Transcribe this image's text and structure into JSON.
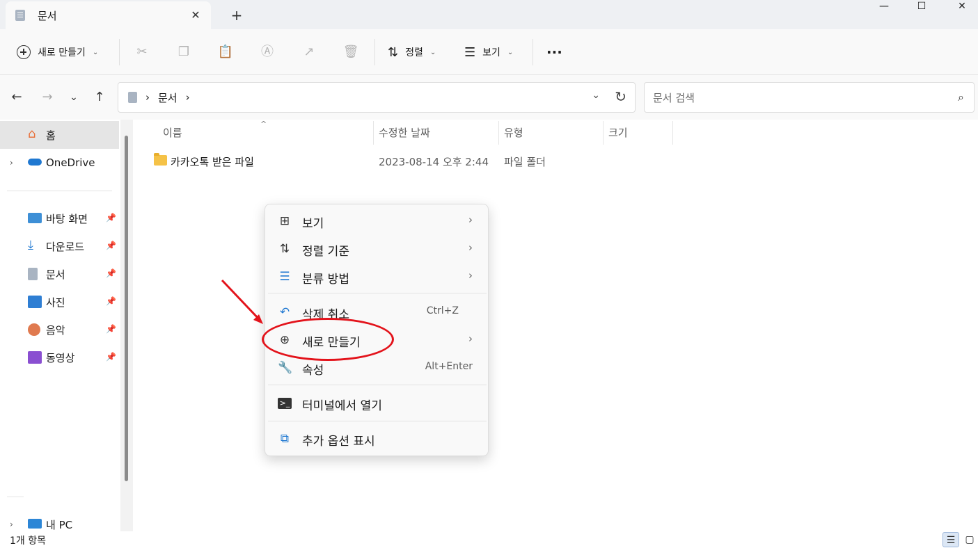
{
  "window": {
    "tab_title": "문서",
    "tab_close": "✕",
    "new_tab": "+",
    "minimize": "—",
    "maximize": "☐",
    "close": "✕"
  },
  "toolbar": {
    "new_label": "새로 만들기",
    "sort_label": "정렬",
    "view_label": "보기",
    "more_label": "···",
    "icons": [
      "cut-icon",
      "copy-icon",
      "paste-icon",
      "rename-icon",
      "share-icon",
      "delete-icon"
    ]
  },
  "address": {
    "location": "문서",
    "separator": "›",
    "search_placeholder": "문서 검색"
  },
  "sidebar": {
    "items": [
      {
        "label": "홈",
        "icon": "home-icon",
        "selected": true
      },
      {
        "label": "OneDrive",
        "icon": "onedrive-icon"
      },
      {
        "label": "바탕 화면",
        "icon": "desktop-icon",
        "pinned": true
      },
      {
        "label": "다운로드",
        "icon": "download-icon",
        "pinned": true
      },
      {
        "label": "문서",
        "icon": "documents-icon",
        "pinned": true
      },
      {
        "label": "사진",
        "icon": "pictures-icon",
        "pinned": true
      },
      {
        "label": "음악",
        "icon": "music-icon",
        "pinned": true
      },
      {
        "label": "동영상",
        "icon": "videos-icon",
        "pinned": true
      },
      {
        "label": "내 PC",
        "icon": "pc-icon"
      }
    ]
  },
  "file_list": {
    "columns": [
      "이름",
      "수정한 날짜",
      "유형",
      "크기"
    ],
    "rows": [
      {
        "name": "카카오톡 받은 파일",
        "date": "2023-08-14 오후 2:44",
        "type": "파일 폴더",
        "size": ""
      }
    ]
  },
  "context_menu": {
    "items": [
      {
        "label": "보기",
        "icon": "grid-icon",
        "submenu": true
      },
      {
        "label": "정렬 기준",
        "icon": "sort-icon",
        "submenu": true
      },
      {
        "label": "분류 방법",
        "icon": "group-icon",
        "submenu": true
      },
      {
        "label": "삭제 취소",
        "icon": "undo-icon",
        "shortcut": "Ctrl+Z"
      },
      {
        "label": "새로 만들기",
        "icon": "new-icon",
        "submenu": true,
        "highlighted_by_annotation": true
      },
      {
        "label": "속성",
        "icon": "properties-icon",
        "shortcut": "Alt+Enter"
      },
      {
        "label": "터미널에서 열기",
        "icon": "terminal-icon"
      },
      {
        "label": "추가 옵션 표시",
        "icon": "more-options-icon"
      }
    ]
  },
  "status": {
    "item_count": "1개 항목"
  },
  "colors": {
    "annotation": "#e3131b",
    "folder": "#f5c247",
    "selected_bg": "#e5e5e5"
  }
}
